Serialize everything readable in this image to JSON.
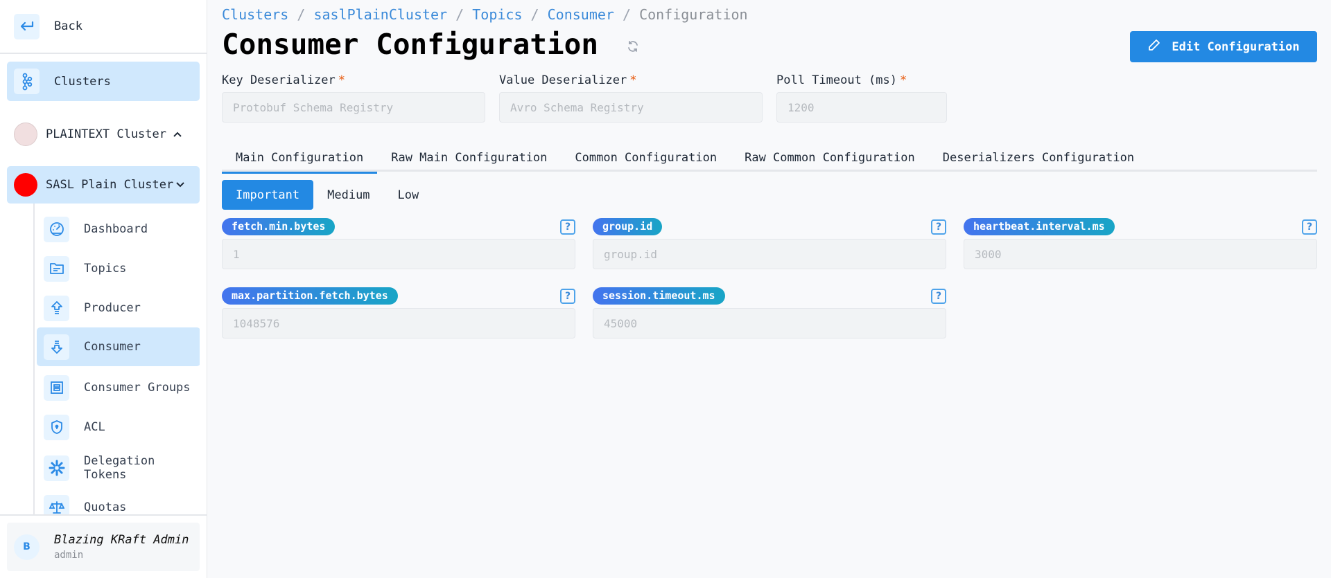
{
  "sidebar": {
    "back_label": "Back",
    "clusters_label": "Clusters",
    "clusters": [
      {
        "label": "PLAINTEXT Cluster",
        "color": "#f1dfe0",
        "expanded": false,
        "chevron": "^"
      },
      {
        "label": "SASL Plain Cluster",
        "color": "#ff0000",
        "expanded": true,
        "chevron": "˅"
      }
    ],
    "items": [
      {
        "label": "Dashboard",
        "icon": "gauge-icon"
      },
      {
        "label": "Topics",
        "icon": "folder-icon"
      },
      {
        "label": "Producer",
        "icon": "upload-arrow-icon"
      },
      {
        "label": "Consumer",
        "icon": "download-arrow-icon",
        "active": true
      },
      {
        "label": "Consumer Groups",
        "icon": "group-box-icon"
      },
      {
        "label": "ACL",
        "icon": "shield-icon"
      },
      {
        "label": "Delegation Tokens",
        "icon": "snowflake-icon"
      },
      {
        "label": "Quotas",
        "icon": "scale-icon"
      }
    ],
    "user": {
      "initial": "B",
      "name": "Blazing KRaft Admin",
      "role": "admin"
    }
  },
  "breadcrumb": {
    "items": [
      "Clusters",
      "saslPlainCluster",
      "Topics",
      "Consumer"
    ],
    "current": "Configuration",
    "separator": " / "
  },
  "header": {
    "title": "Consumer Configuration",
    "edit_button": "Edit Configuration"
  },
  "deserializers": {
    "key": {
      "label": "Key Deserializer",
      "required": "*",
      "value": "Protobuf Schema Registry"
    },
    "value": {
      "label": "Value Deserializer",
      "required": "*",
      "value": "Avro Schema Registry"
    },
    "poll": {
      "label": "Poll Timeout (ms)",
      "required": "*",
      "value": "1200"
    }
  },
  "tabs": [
    {
      "label": "Main Configuration",
      "active": true
    },
    {
      "label": "Raw Main Configuration"
    },
    {
      "label": "Common Configuration"
    },
    {
      "label": "Raw Common Configuration"
    },
    {
      "label": "Deserializers Configuration"
    }
  ],
  "importance": [
    {
      "label": "Important",
      "active": true
    },
    {
      "label": "Medium"
    },
    {
      "label": "Low"
    }
  ],
  "config_fields": [
    {
      "key": "fetch.min.bytes",
      "value": "1",
      "help": "?"
    },
    {
      "key": "group.id",
      "value": "",
      "placeholder": "group.id",
      "help": "?"
    },
    {
      "key": "heartbeat.interval.ms",
      "value": "3000",
      "help": "?"
    },
    {
      "key": "max.partition.fetch.bytes",
      "value": "1048576",
      "help": "?"
    },
    {
      "key": "session.timeout.ms",
      "value": "45000",
      "help": "?"
    }
  ],
  "colors": {
    "accent": "#2389e3",
    "active_bg": "#d0e8fd",
    "link": "#3b8ad9"
  }
}
